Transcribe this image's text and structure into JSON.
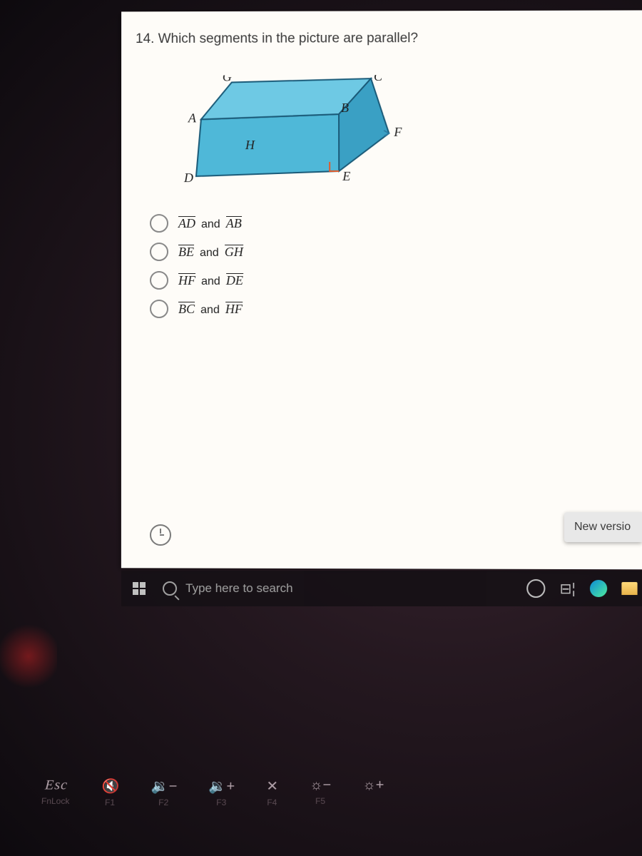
{
  "question": {
    "number": "14.",
    "text": "Which segments in the picture are parallel?"
  },
  "diagram_labels": {
    "A": "A",
    "B": "B",
    "C": "C",
    "D": "D",
    "E": "E",
    "F": "F",
    "G": "G",
    "H": "H"
  },
  "options": [
    {
      "seg1": "AD",
      "seg2": "AB"
    },
    {
      "seg1": "BE",
      "seg2": "GH"
    },
    {
      "seg1": "HF",
      "seg2": "DE"
    },
    {
      "seg1": "BC",
      "seg2": "HF"
    }
  ],
  "and_word": "and",
  "new_version_label": "New versio",
  "taskbar": {
    "search_placeholder": "Type here to search"
  },
  "keyboard": {
    "esc": "Esc",
    "esc_sub": "FnLock",
    "f1": "F1",
    "f2": "F2",
    "f3": "F3",
    "f4": "F4",
    "f5": "F5"
  }
}
